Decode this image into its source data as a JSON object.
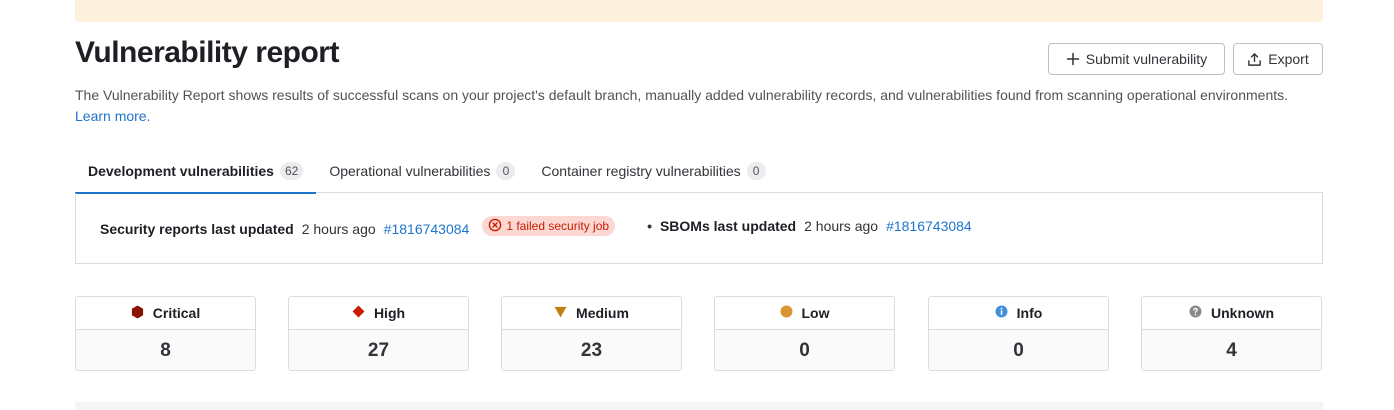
{
  "header": {
    "title": "Vulnerability report",
    "submit_label": "Submit vulnerability",
    "export_label": "Export"
  },
  "description": {
    "text": "The Vulnerability Report shows results of successful scans on your project's default branch, manually added vulnerability records, and vulnerabilities found from scanning operational environments.",
    "learn_more": "Learn more."
  },
  "tabs": [
    {
      "label": "Development vulnerabilities",
      "count": "62",
      "active": true
    },
    {
      "label": "Operational vulnerabilities",
      "count": "0",
      "active": false
    },
    {
      "label": "Container registry vulnerabilities",
      "count": "0",
      "active": false
    }
  ],
  "status": {
    "security_label": "Security reports last updated",
    "security_time": "2 hours ago",
    "security_pipeline": "#1816743084",
    "failed_job": "1 failed security job",
    "bullet": "•",
    "sbom_label": "SBOMs last updated",
    "sbom_time": "2 hours ago",
    "sbom_pipeline": "#1816743084"
  },
  "severities": [
    {
      "label": "Critical",
      "count": "8",
      "icon": "critical-icon",
      "color": "#8d1300"
    },
    {
      "label": "High",
      "count": "27",
      "icon": "high-icon",
      "color": "#c91c00"
    },
    {
      "label": "Medium",
      "count": "23",
      "icon": "medium-icon",
      "color": "#c17d10"
    },
    {
      "label": "Low",
      "count": "0",
      "icon": "low-icon",
      "color": "#d99530"
    },
    {
      "label": "Info",
      "count": "0",
      "icon": "info-icon",
      "color": "#428fdc"
    },
    {
      "label": "Unknown",
      "count": "4",
      "icon": "unknown-icon",
      "color": "#89888d"
    }
  ],
  "colors": {
    "accent": "#1f75cb",
    "banner": "#fdf1dd",
    "failed_badge_bg": "#fcd8d3",
    "failed_badge_text": "#c91c00"
  }
}
